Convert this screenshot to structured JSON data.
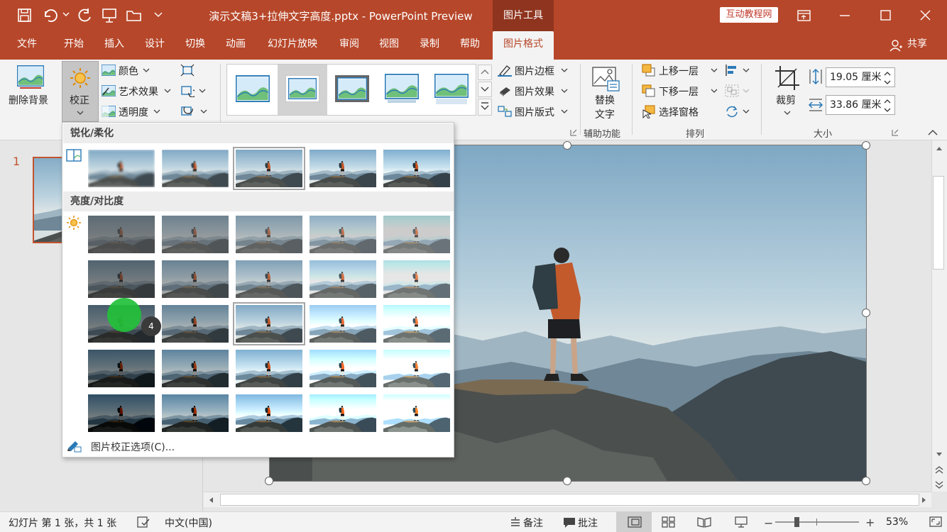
{
  "window": {
    "title": "演示文稿3+拉伸文字高度.pptx  -  PowerPoint Preview",
    "contextual_tab_title": "图片工具",
    "brand_badge": "互动教程网"
  },
  "tabs": [
    "文件",
    "开始",
    "插入",
    "设计",
    "切换",
    "动画",
    "幻灯片放映",
    "审阅",
    "视图",
    "录制",
    "帮助",
    "图片格式"
  ],
  "share_label": "共享",
  "ribbon": {
    "remove_background": "删除背景",
    "corrections": "校正",
    "color": "颜色",
    "artistic_effects": "艺术效果",
    "transparency": "透明度",
    "picture_border": "图片边框",
    "picture_effects": "图片效果",
    "picture_layout": "图片版式",
    "alt_text_line1": "替换",
    "alt_text_line2": "文字",
    "accessibility_group": "辅助功能",
    "bring_forward": "上移一层",
    "send_backward": "下移一层",
    "selection_pane": "选择窗格",
    "arrange_group": "排列",
    "crop": "裁剪",
    "height_value": "19.05 厘米",
    "width_value": "33.86 厘米",
    "size_group": "大小"
  },
  "corrections_panel": {
    "sharpen_section": "锐化/柔化",
    "brightness_section": "亮度/对比度",
    "options_link": "图片校正选项(C)...",
    "click_badge": "4",
    "sharpen_row": [
      {
        "blur": 2
      },
      {
        "blur": 1
      },
      {
        "blur": 0,
        "selected": true
      },
      {
        "blur": 0,
        "sharp": 1
      },
      {
        "blur": 0,
        "sharp": 2
      }
    ],
    "brightness_grid": [
      [
        {
          "b": 0.55,
          "c": 0.6
        },
        {
          "b": 0.78,
          "c": 0.6
        },
        {
          "b": 1.0,
          "c": 0.6
        },
        {
          "b": 1.22,
          "c": 0.6
        },
        {
          "b": 1.45,
          "c": 0.6
        }
      ],
      [
        {
          "b": 0.55,
          "c": 0.8
        },
        {
          "b": 0.78,
          "c": 0.8
        },
        {
          "b": 1.0,
          "c": 0.8
        },
        {
          "b": 1.22,
          "c": 0.8
        },
        {
          "b": 1.45,
          "c": 0.8
        }
      ],
      [
        {
          "b": 0.55,
          "c": 1.0
        },
        {
          "b": 0.78,
          "c": 1.0
        },
        {
          "b": 1.0,
          "c": 1.0,
          "selected": true
        },
        {
          "b": 1.22,
          "c": 1.0
        },
        {
          "b": 1.45,
          "c": 1.0
        }
      ],
      [
        {
          "b": 0.55,
          "c": 1.2
        },
        {
          "b": 0.78,
          "c": 1.2
        },
        {
          "b": 1.0,
          "c": 1.2
        },
        {
          "b": 1.22,
          "c": 1.2
        },
        {
          "b": 1.45,
          "c": 1.2
        }
      ],
      [
        {
          "b": 0.55,
          "c": 1.4
        },
        {
          "b": 0.78,
          "c": 1.4
        },
        {
          "b": 1.0,
          "c": 1.4
        },
        {
          "b": 1.22,
          "c": 1.4
        },
        {
          "b": 1.45,
          "c": 1.4
        }
      ]
    ]
  },
  "slide_panel": {
    "slide_number": "1"
  },
  "statusbar": {
    "slide_info": "幻灯片 第 1 张，共 1 张",
    "language": "中文(中国)",
    "notes": "备注",
    "comments": "批注",
    "zoom": "53%"
  },
  "colors": {
    "accent": "#b7472a",
    "accent_dark": "#8f341e",
    "ribbon_bg": "#f3f3f3",
    "click_marker": "#22c03a"
  }
}
